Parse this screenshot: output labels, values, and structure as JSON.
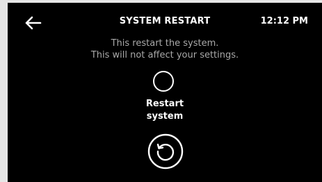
{
  "header": {
    "title": "SYSTEM RESTART",
    "time": "12:12 PM",
    "back_icon": "arrow-left-icon"
  },
  "description": {
    "line1": "This restart the system.",
    "line2": "This will not affect your settings."
  },
  "option": {
    "selected": false,
    "label_line1": "Restart",
    "label_line2": "system"
  },
  "action": {
    "icon": "restart-icon"
  },
  "colors": {
    "background": "#000000",
    "text": "#ffffff",
    "muted_text": "#a9a9a9",
    "outer_margin": "#e6e6e6"
  }
}
